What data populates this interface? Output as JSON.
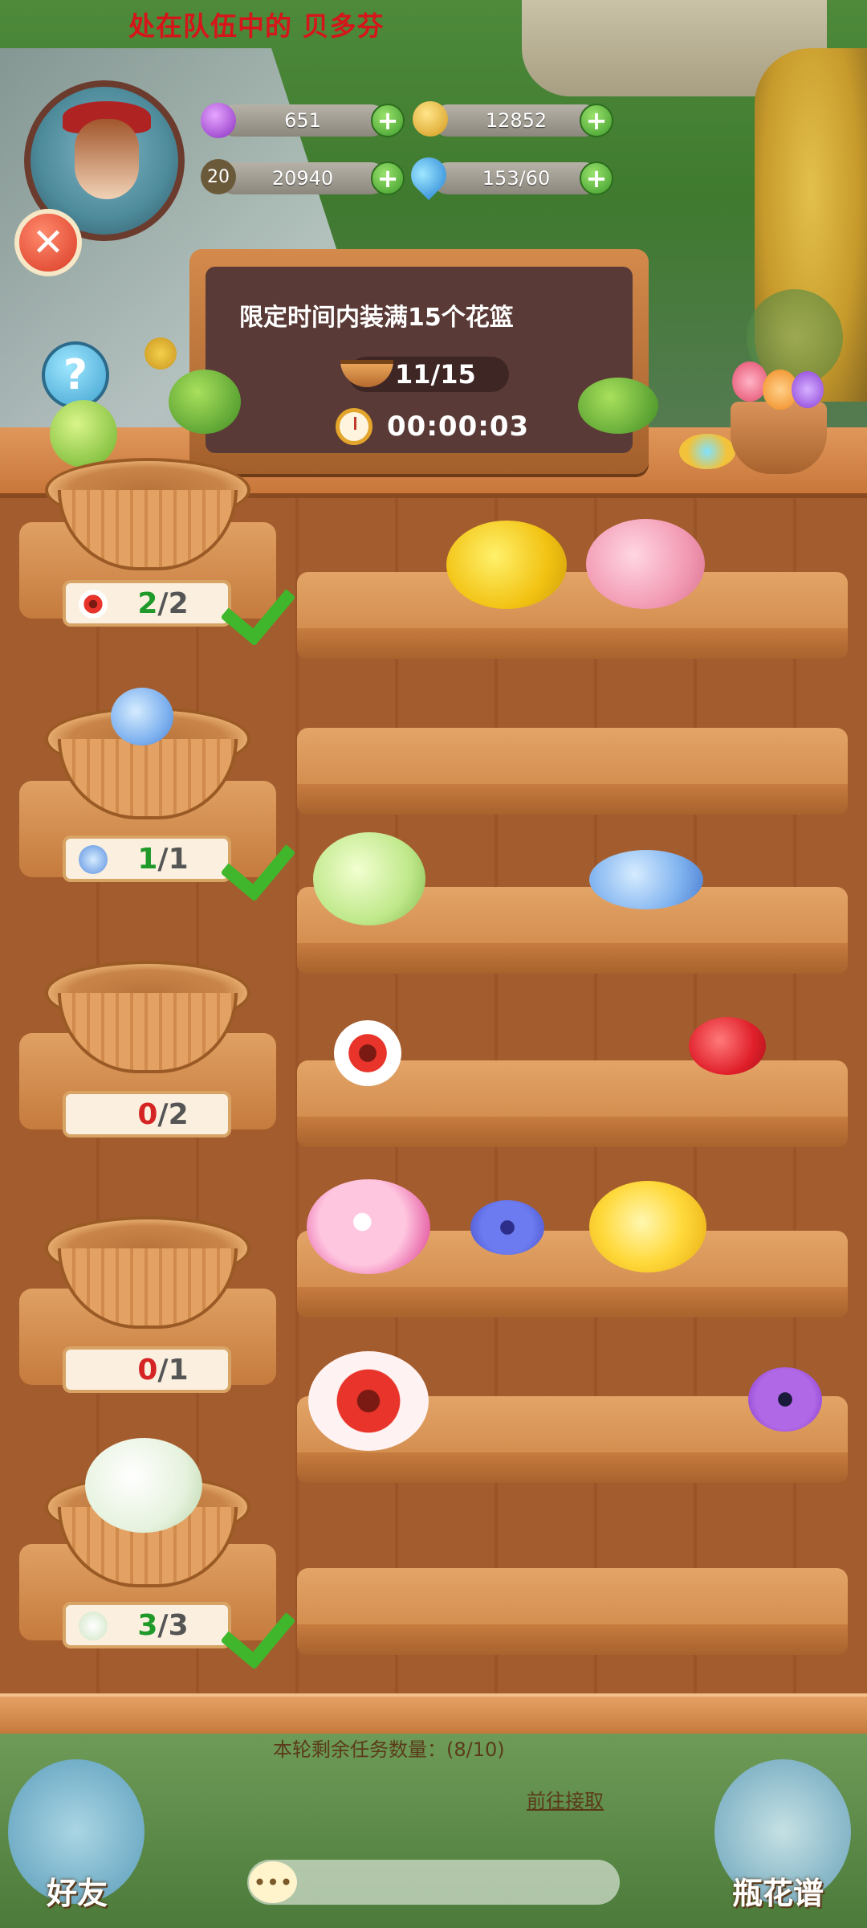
{
  "header": {
    "team_text": "处在队伍中的 贝多芬",
    "level": "20"
  },
  "resources": {
    "gems": "651",
    "coins": "12852",
    "exp": "20940",
    "water": "153/60"
  },
  "task_board": {
    "goal": "限定时间内装满15个花篮",
    "progress": "11/15",
    "timer": "00:00:03"
  },
  "baskets": [
    {
      "current": "2",
      "total": "2",
      "flower": "gaillardia",
      "done": true
    },
    {
      "current": "1",
      "total": "1",
      "flower": "blue-hydrangea",
      "done": true
    },
    {
      "current": "0",
      "total": "2",
      "flower": "",
      "done": false
    },
    {
      "current": "0",
      "total": "1",
      "flower": "",
      "done": false
    },
    {
      "current": "3",
      "total": "3",
      "flower": "white-hydrangea",
      "done": true
    }
  ],
  "shelves": [
    {
      "flowers": [
        "yellow-rose",
        "pink-hydrangea"
      ]
    },
    {
      "flowers": []
    },
    {
      "flowers": [
        "green-rose",
        "blue-hydrangea"
      ]
    },
    {
      "flowers": [
        "gaillardia",
        "red-hibiscus"
      ]
    },
    {
      "flowers": [
        "pink-lily",
        "blue-cornflower",
        "yellow-lily"
      ]
    },
    {
      "flowers": [
        "gaillardia",
        "purple-anemone"
      ]
    },
    {
      "flowers": []
    }
  ],
  "bottom": {
    "task_remaining": "本轮剩余任务数量：(8/10)",
    "goto": "前往接取",
    "friends": "好友",
    "flower_book": "瓶花谱"
  },
  "colors": {
    "done_green": "#1f9a2a",
    "zero_red": "#d52424",
    "wood": "#c98549"
  }
}
